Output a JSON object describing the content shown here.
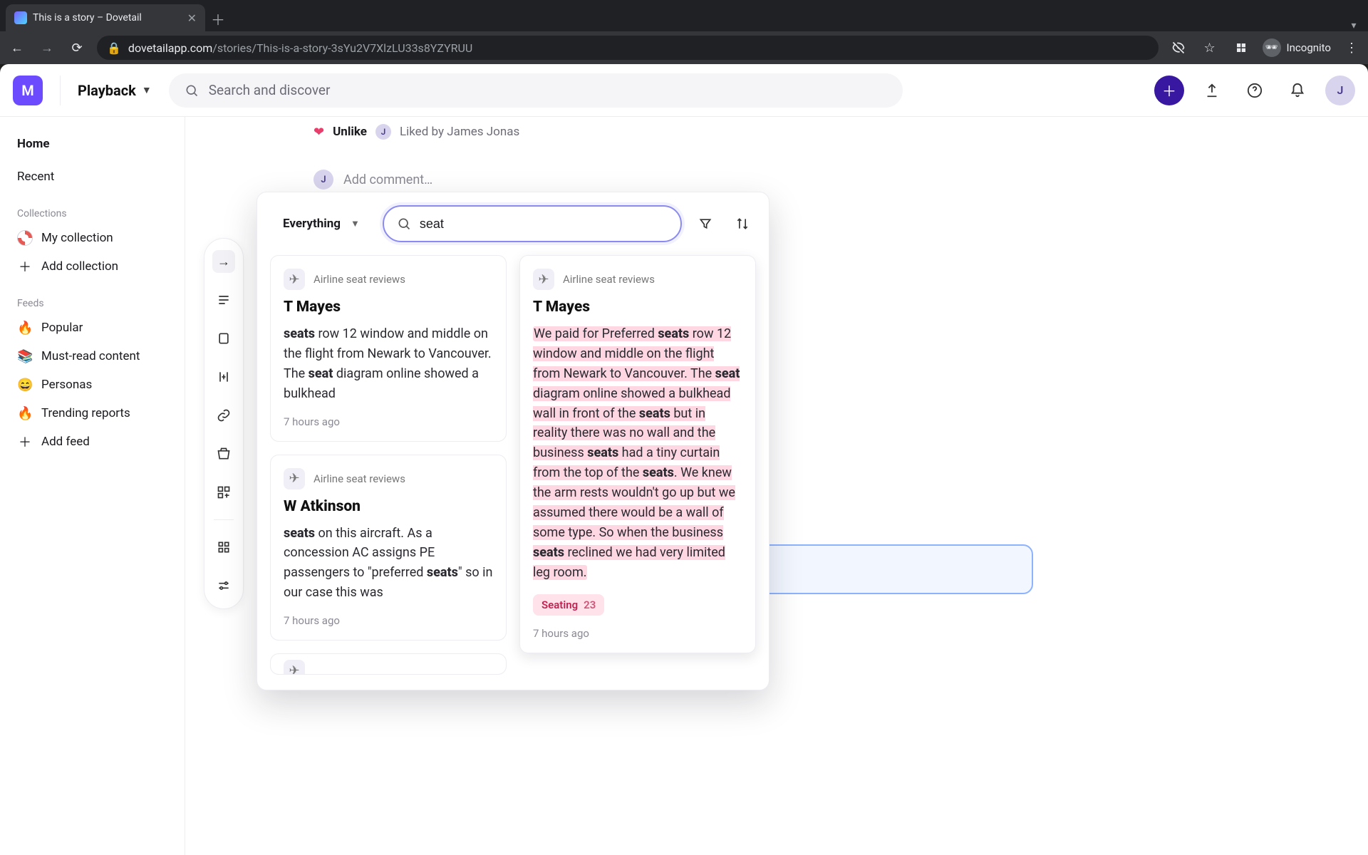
{
  "browser": {
    "tab_title": "This is a story – Dovetail",
    "url_host": "dovetailapp.com",
    "url_path": "/stories/This-is-a-story-3sYu2V7XlzLU33s8YZYRUU",
    "incognito_label": "Incognito"
  },
  "topbar": {
    "workspace_initial": "M",
    "playback_label": "Playback",
    "search_placeholder": "Search and discover",
    "avatar_initial": "J"
  },
  "sidebar": {
    "home": "Home",
    "recent": "Recent",
    "collections_label": "Collections",
    "my_collection": "My collection",
    "add_collection": "Add collection",
    "feeds_label": "Feeds",
    "feeds": [
      {
        "emoji": "🔥",
        "label": "Popular"
      },
      {
        "emoji": "📚",
        "label": "Must-read content"
      },
      {
        "emoji": "😄",
        "label": "Personas"
      },
      {
        "emoji": "🔥",
        "label": "Trending reports"
      }
    ],
    "add_feed": "Add feed"
  },
  "story_bg": {
    "unlike_label": "Unlike",
    "liked_by_prefix": "Liked by ",
    "liked_by_name": "James Jonas",
    "j_initial": "J",
    "comment_placeholder": "Add comment…"
  },
  "popup": {
    "scope_label": "Everything",
    "search_value": "seat",
    "results": {
      "left": [
        {
          "source": "Airline seat reviews",
          "title": "T Mayes",
          "body_html": "<b>seats</b> row 12 window and middle on the flight from Newark to Vancouver. The <b>seat</b> diagram online showed a bulkhead",
          "time": "7 hours ago"
        },
        {
          "source": "Airline seat reviews",
          "title": "W Atkinson",
          "body_html": "<b>seats</b> on this aircraft. As a concession AC assigns PE passengers to \"preferred <b>seats</b>\" so in our case this was",
          "time": "7 hours ago"
        }
      ],
      "right": [
        {
          "source": "Airline seat reviews",
          "title": "T Mayes",
          "body_html": "<span class='hl'>We paid for Preferred <b>seats</b> row 12 window and middle on the flight from Newark to Vancouver. The <b>seat</b> diagram online showed a bulkhead wall in front of the <b>seats</b> but in reality there was no wall and the business <b>seats</b> had a tiny curtain from the top of the <b>seats</b>. We knew the arm rests wouldn't go up but we assumed there would be a wall of some type. So when the business <b>seats</b> reclined we had very limited leg room.</span>",
          "tag_label": "Seating",
          "tag_count": "23",
          "time": "7 hours ago"
        }
      ]
    }
  }
}
